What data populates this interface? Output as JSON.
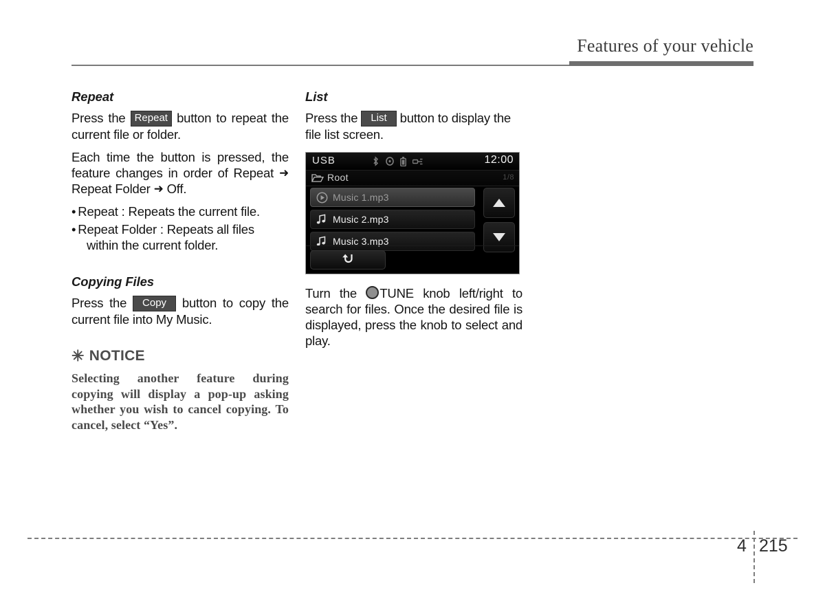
{
  "header": {
    "title": "Features of your vehicle"
  },
  "left_column": {
    "repeat_section": {
      "heading": "Repeat",
      "para1_before": "Press the",
      "para1_chip": "Repeat",
      "para1_after": "button to repeat the current file or folder.",
      "para2_before": "Each time the button is pressed, the feature changes in order of Repeat",
      "arrow": "➜",
      "para2_mid": "Repeat Folder",
      "para2_after": "Off.",
      "bullets": [
        {
          "text": "Repeat : Repeats the current file."
        },
        {
          "text": "Repeat Folder : Repeats all files",
          "continuation": "within the current folder."
        }
      ]
    },
    "copying_section": {
      "heading": "Copying Files",
      "para_before": "Press the",
      "para_chip": "Copy",
      "para_after": "button to copy the current file into My Music."
    },
    "notice": {
      "asterisk": "✳",
      "heading": "NOTICE",
      "body": "Selecting another feature during copying will display a pop-up asking whether you wish to cancel copying. To cancel, select “Yes”."
    }
  },
  "right_column": {
    "list_section": {
      "heading": "List",
      "para_before": "Press the",
      "para_chip": "List",
      "para_after": "button to display the file list screen."
    },
    "tune_para": {
      "before": "Turn the",
      "knob_icon": "tune-knob-icon",
      "after": "TUNE knob left/right to search for files. Once the desired file is displayed, press the knob to select and play."
    }
  },
  "screen": {
    "source_label": "USB",
    "clock": "12:00",
    "status_icons": [
      "bluetooth-icon",
      "disc-icon",
      "battery-icon",
      "usb-plug-icon"
    ],
    "path_label": "Root",
    "path_icon": "folder-open-icon",
    "page_indicator": "1/8",
    "rows": [
      {
        "label": "Music 1.mp3",
        "icon": "play-circle-icon",
        "selected": true
      },
      {
        "label": "Music 2.mp3",
        "icon": "music-note-icon",
        "selected": false
      },
      {
        "label": "Music 3.mp3",
        "icon": "music-note-icon",
        "selected": false
      }
    ],
    "scroll_up": "scroll-up-icon",
    "scroll_down": "scroll-down-icon",
    "back_button": "back-arrow-icon"
  },
  "footer": {
    "chapter": "4",
    "page": "215"
  },
  "colors": {
    "page_background": "#ffffff",
    "text": "#141414",
    "header_rule": "#6e6e6e",
    "chip_background": "#4a4a4a",
    "notice_text": "#4a4a4a",
    "screen_background": "#000000",
    "screen_text": "#f0f0f0",
    "screen_selected_text": "#9b9b9b"
  }
}
